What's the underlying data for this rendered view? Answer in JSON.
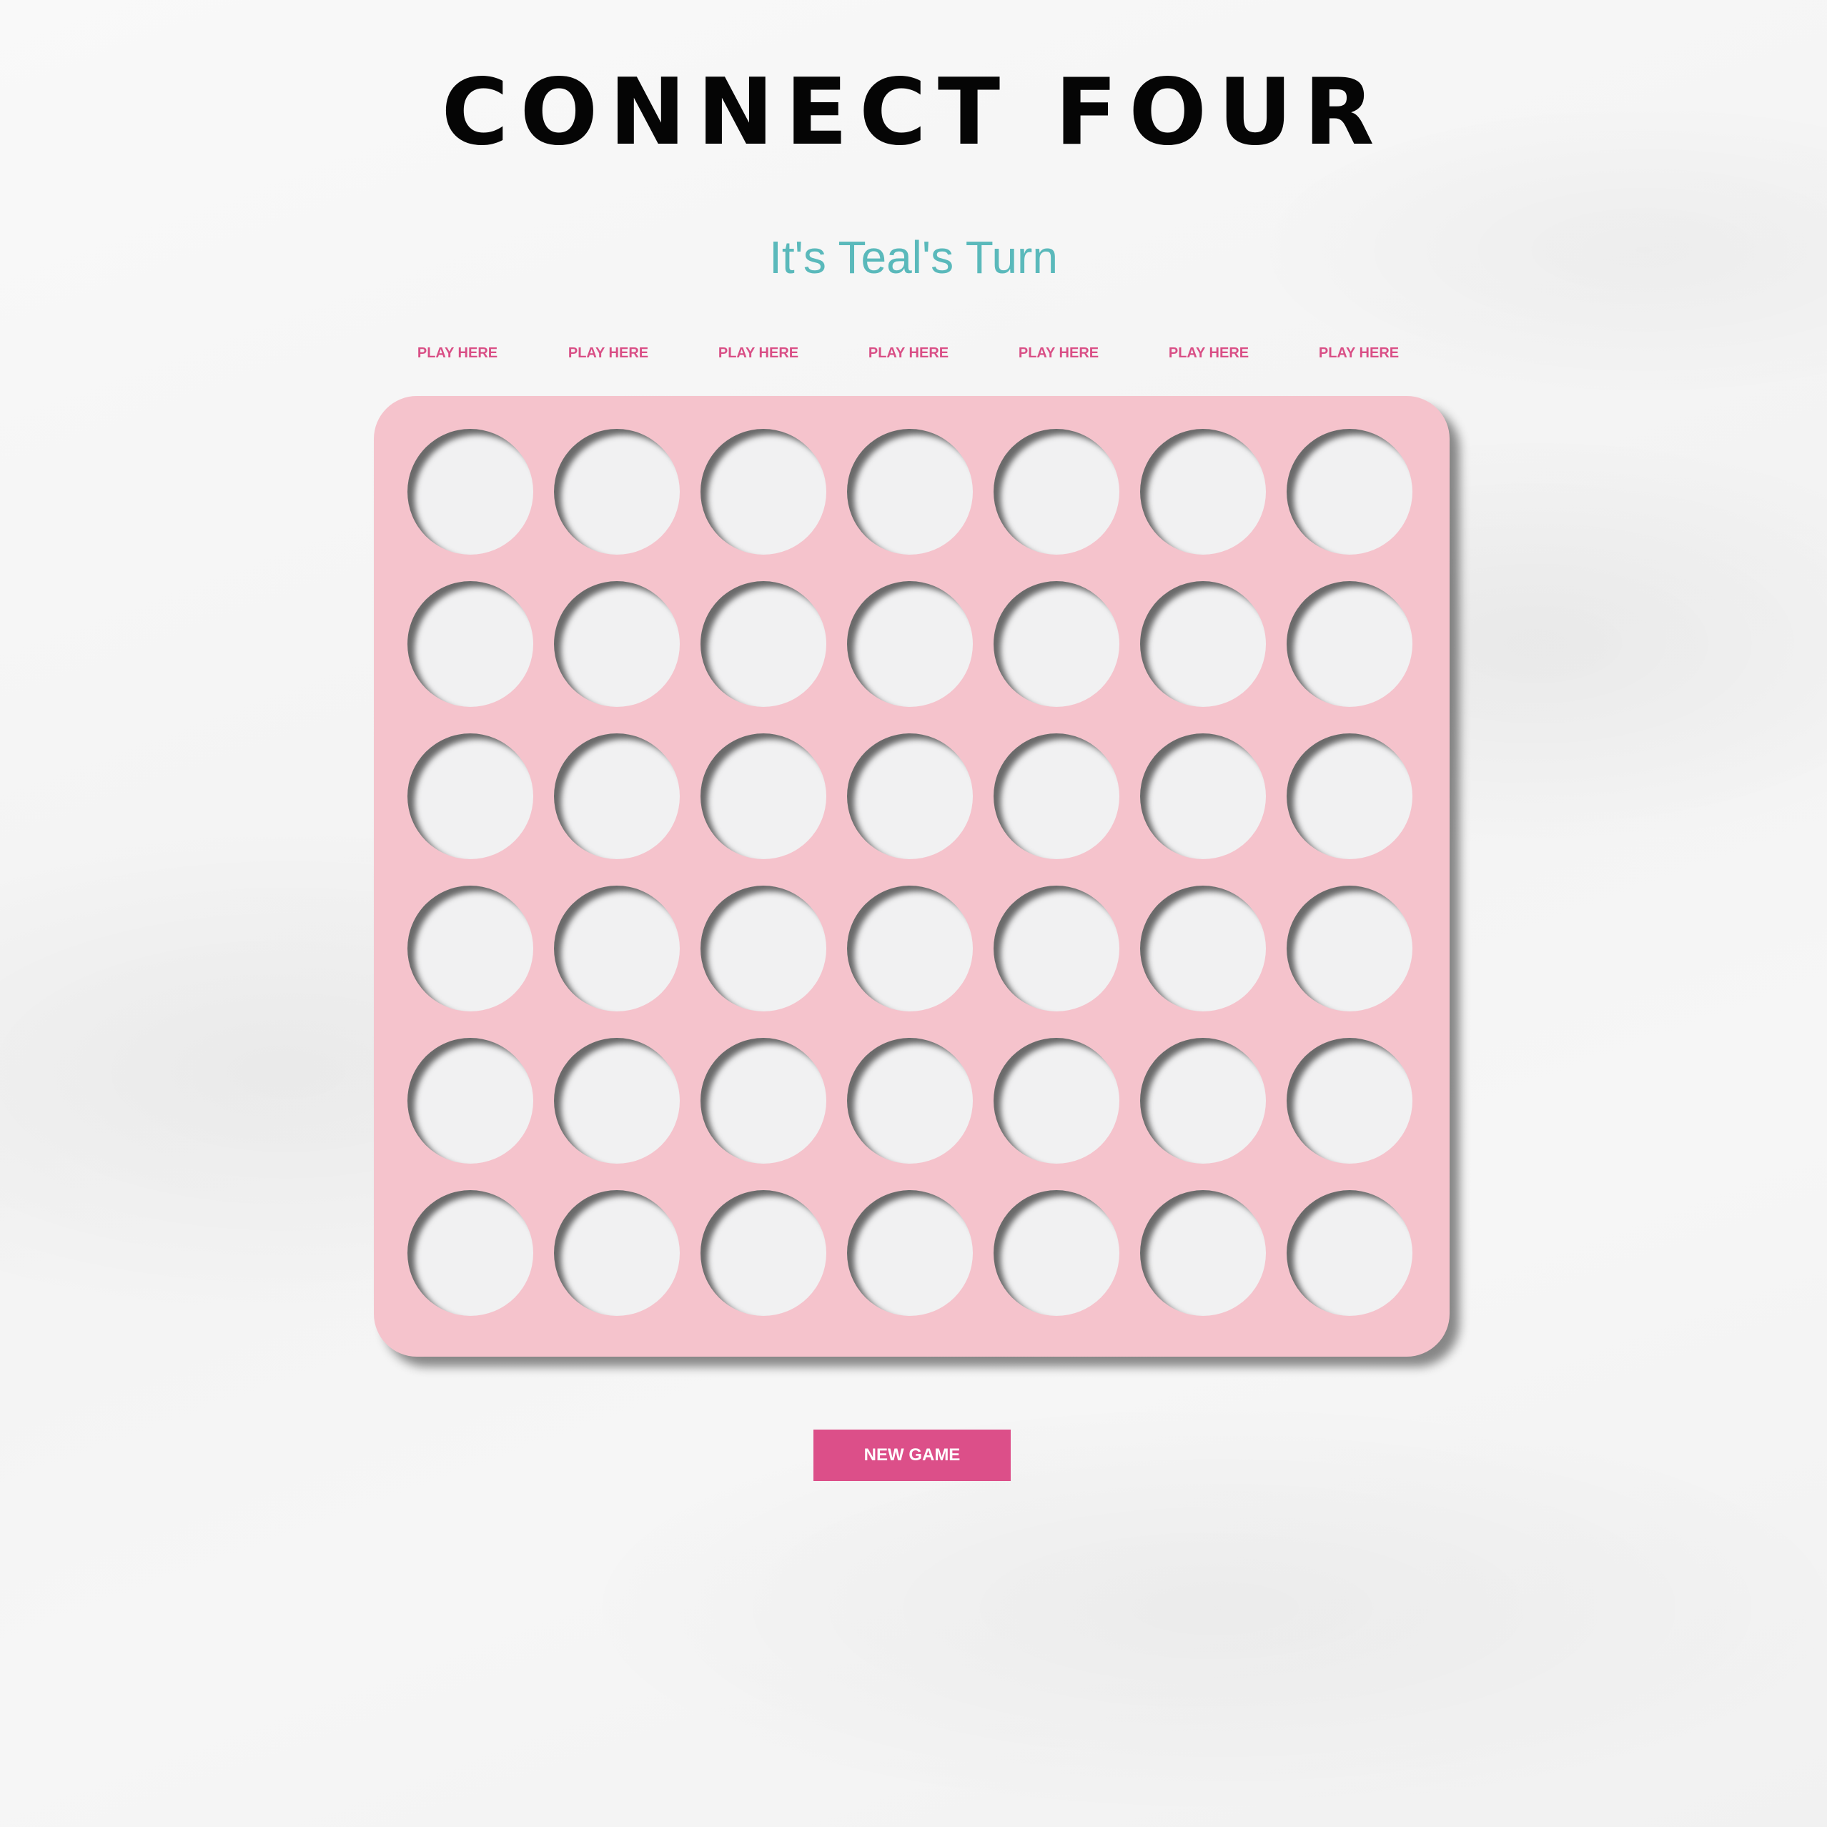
{
  "header": {
    "title": "CONNECT FOUR"
  },
  "status": {
    "turn_text": "It's Teal's Turn",
    "current_player": "Teal",
    "teal_color": "#5ab9bb"
  },
  "columns": [
    {
      "label": "PLAY HERE"
    },
    {
      "label": "PLAY HERE"
    },
    {
      "label": "PLAY HERE"
    },
    {
      "label": "PLAY HERE"
    },
    {
      "label": "PLAY HERE"
    },
    {
      "label": "PLAY HERE"
    },
    {
      "label": "PLAY HERE"
    }
  ],
  "board": {
    "rows": 6,
    "cols": 7,
    "color": "#f5c3cc",
    "cells": [
      [
        "empty",
        "empty",
        "empty",
        "empty",
        "empty",
        "empty",
        "empty"
      ],
      [
        "empty",
        "empty",
        "empty",
        "empty",
        "empty",
        "empty",
        "empty"
      ],
      [
        "empty",
        "empty",
        "empty",
        "empty",
        "empty",
        "empty",
        "empty"
      ],
      [
        "empty",
        "empty",
        "empty",
        "empty",
        "empty",
        "empty",
        "empty"
      ],
      [
        "empty",
        "empty",
        "empty",
        "empty",
        "empty",
        "empty",
        "empty"
      ],
      [
        "empty",
        "empty",
        "empty",
        "empty",
        "empty",
        "empty",
        "empty"
      ]
    ]
  },
  "controls": {
    "new_game_label": "NEW GAME",
    "accent_color": "#dc4f89"
  }
}
